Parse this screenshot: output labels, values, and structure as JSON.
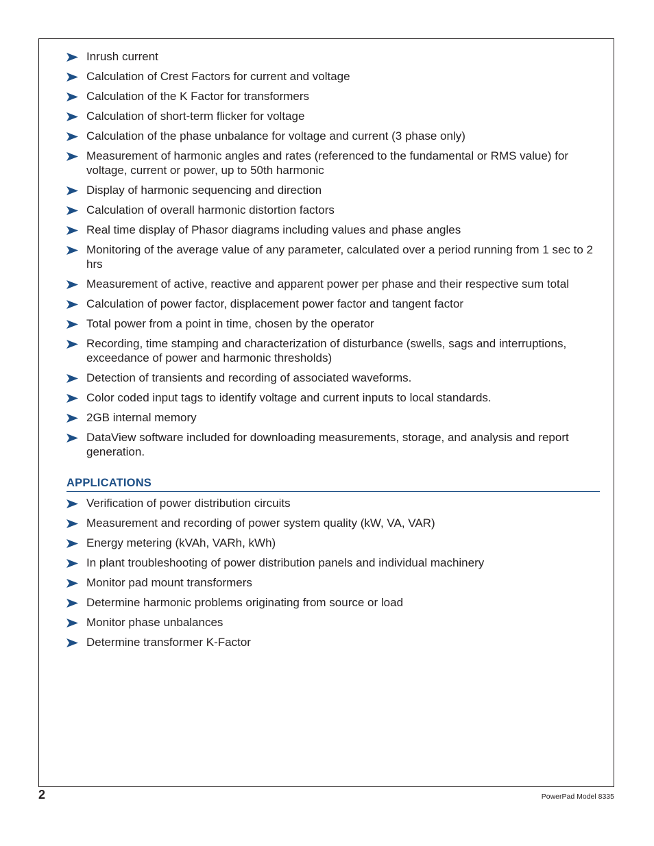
{
  "features": [
    "Inrush current",
    "Calculation of Crest Factors for current and voltage",
    "Calculation of the K Factor for transformers",
    "Calculation of short-term flicker for voltage",
    "Calculation of the phase unbalance for voltage and current (3 phase only)",
    "Measurement of harmonic angles and rates (referenced to the fundamental or RMS value) for voltage, current or power, up to 50th harmonic",
    "Display of harmonic sequencing and direction",
    "Calculation of overall harmonic distortion factors",
    "Real time display of Phasor diagrams including values and phase angles",
    "Monitoring of the average value of any parameter, calculated over a period running from 1 sec to 2 hrs",
    "Measurement of active, reactive and apparent power per phase and their respective sum total",
    "Calculation of power factor, displacement power factor and tangent factor",
    "Total power from a point in time, chosen by the operator",
    "Recording, time stamping and characterization of disturbance (swells, sags and interruptions, exceedance of power and harmonic thresholds)",
    "Detection of transients and recording of associated waveforms.",
    "Color coded input tags to identify voltage and current inputs to local standards.",
    "2GB internal memory",
    "DataView software included for downloading measurements, storage, and analysis and report generation."
  ],
  "applications": {
    "heading": "APPLICATIONS",
    "items": [
      "Verification of power distribution circuits",
      "Measurement and recording of power system quality (kW, VA, VAR)",
      "Energy metering (kVAh, VARh, kWh)",
      "In plant troubleshooting of power distribution panels and individual machinery",
      "Monitor pad mount transformers",
      "Determine harmonic problems originating from source or load",
      "Monitor phase unbalances",
      "Determine transformer K-Factor"
    ]
  },
  "footer": {
    "page_number": "2",
    "model": "PowerPad Model 8335"
  },
  "colors": {
    "accent": "#1d4f86"
  }
}
